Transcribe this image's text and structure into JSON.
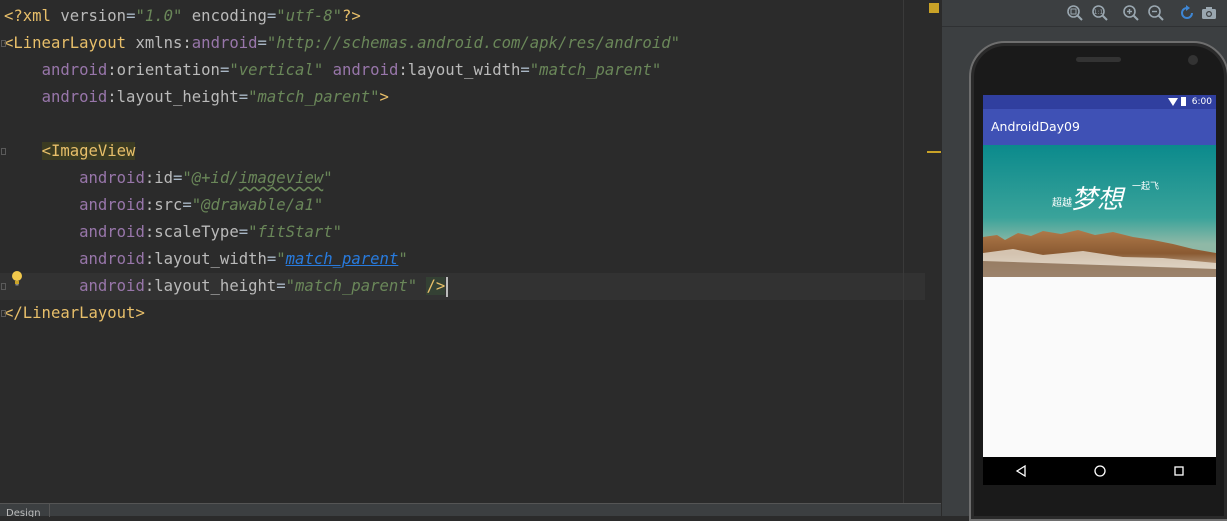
{
  "editor": {
    "lines": [
      [
        [
          "t-bracket",
          "<?"
        ],
        [
          "t-tag",
          "xml"
        ],
        [
          "t-plain",
          " "
        ],
        [
          "t-attr",
          "version"
        ],
        [
          "t-plain",
          "="
        ],
        [
          "t-val",
          "\"1.0\""
        ],
        [
          "t-plain",
          " "
        ],
        [
          "t-attr",
          "encoding"
        ],
        [
          "t-plain",
          "="
        ],
        [
          "t-val",
          "\"utf-8\""
        ],
        [
          "t-bracket",
          "?>"
        ]
      ],
      [
        [
          "t-bracket",
          "<"
        ],
        [
          "t-tag",
          "LinearLayout"
        ],
        [
          "t-plain",
          " "
        ],
        [
          "t-attr",
          "xmlns:"
        ],
        [
          "t-ns",
          "android"
        ],
        [
          "t-plain",
          "="
        ],
        [
          "t-val",
          "\"http://schemas.android.com/apk/res/android\""
        ]
      ],
      [
        [
          "t-plain",
          "    "
        ],
        [
          "t-ns",
          "android"
        ],
        [
          "t-attr",
          ":orientation"
        ],
        [
          "t-plain",
          "="
        ],
        [
          "t-val",
          "\"vertical\""
        ],
        [
          "t-plain",
          " "
        ],
        [
          "t-ns",
          "android"
        ],
        [
          "t-attr",
          ":layout_width"
        ],
        [
          "t-plain",
          "="
        ],
        [
          "t-val",
          "\"match_parent\""
        ]
      ],
      [
        [
          "t-plain",
          "    "
        ],
        [
          "t-ns",
          "android"
        ],
        [
          "t-attr",
          ":layout_height"
        ],
        [
          "t-plain",
          "="
        ],
        [
          "t-val",
          "\"match_parent\""
        ],
        [
          "t-bracket",
          ">"
        ]
      ],
      [],
      [
        [
          "t-plain",
          "    "
        ],
        [
          "t-bracket hl-tag",
          "<"
        ],
        [
          "t-tag hl-tag",
          "ImageView"
        ]
      ],
      [
        [
          "t-plain",
          "        "
        ],
        [
          "t-ns",
          "android"
        ],
        [
          "t-attr",
          ":id"
        ],
        [
          "t-plain",
          "="
        ],
        [
          "t-val",
          "\"@+id/"
        ],
        [
          "t-val t-squiggle",
          "imageview"
        ],
        [
          "t-val",
          "\""
        ]
      ],
      [
        [
          "t-plain",
          "        "
        ],
        [
          "t-ns",
          "android"
        ],
        [
          "t-attr",
          ":src"
        ],
        [
          "t-plain",
          "="
        ],
        [
          "t-val",
          "\"@drawable/a1\""
        ]
      ],
      [
        [
          "t-plain",
          "        "
        ],
        [
          "t-ns",
          "android"
        ],
        [
          "t-attr",
          ":scaleType"
        ],
        [
          "t-plain",
          "="
        ],
        [
          "t-val",
          "\"fitStart\""
        ]
      ],
      [
        [
          "t-plain",
          "        "
        ],
        [
          "t-ns",
          "android"
        ],
        [
          "t-attr",
          ":layout_width"
        ],
        [
          "t-plain",
          "="
        ],
        [
          "t-val",
          "\""
        ],
        [
          "t-link",
          "match_parent"
        ],
        [
          "t-val",
          "\""
        ]
      ],
      [
        [
          "t-plain",
          "        "
        ],
        [
          "t-ns",
          "android"
        ],
        [
          "t-attr",
          ":layout_height"
        ],
        [
          "t-plain",
          "="
        ],
        [
          "t-val",
          "\"match_parent\""
        ],
        [
          "t-plain",
          " "
        ],
        [
          "t-bracket hl-close",
          "/>"
        ]
      ],
      [
        [
          "t-bracket",
          "</"
        ],
        [
          "t-tag",
          "LinearLayout"
        ],
        [
          "t-bracket",
          ">"
        ]
      ]
    ],
    "current_line": 10,
    "bottom_tab_label": "Design"
  },
  "preview": {
    "status_time": "6:00",
    "app_title": "AndroidDay09",
    "image_text": {
      "left": "超越",
      "main": "梦想",
      "right": "一起飞"
    }
  },
  "colors": {
    "app_bar": "#3f51b5",
    "status_bar": "#303f9f",
    "editor_bg": "#2b2b2b"
  }
}
